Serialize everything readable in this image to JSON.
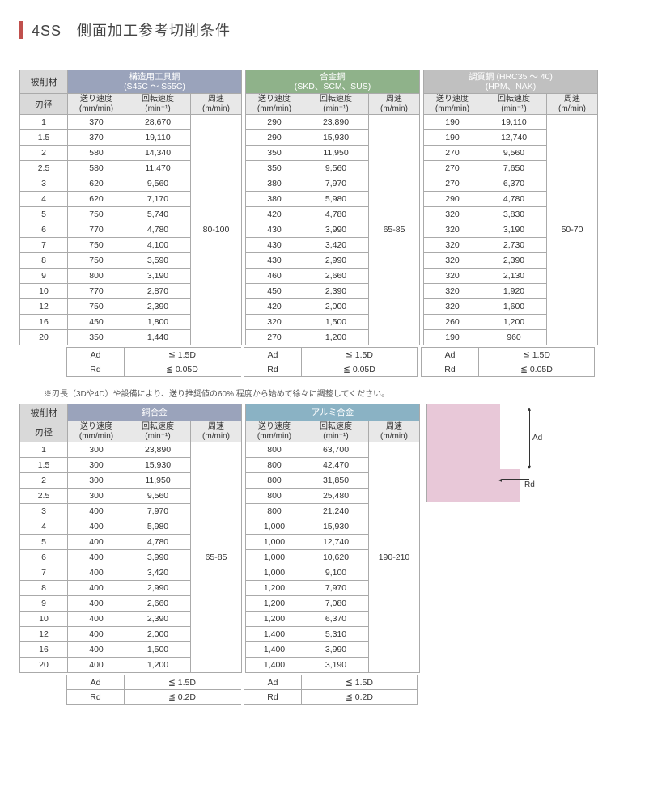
{
  "title": "4SS　側面加工参考切削条件",
  "labels": {
    "workpiece": "被削材",
    "edge": "刃径",
    "feed": "送り速度",
    "feed_u": "(mm/min)",
    "rpm": "回転速度",
    "rpm_u": "(min⁻¹)",
    "speed": "周速",
    "speed_u": "(m/min)",
    "Ad": "Ad",
    "Rd": "Rd"
  },
  "note": "※刃長（3Dや4D）や設備により、送り推奨値の60% 程度から始めて徐々に調整してください。",
  "materials1": [
    {
      "name_l1": "構造用工具鋼",
      "name_l2": "(S45C ～ S55C)",
      "speed": "80-100",
      "ad": "≦ 1.5D",
      "rd": "≦ 0.05D",
      "class": "mat-a",
      "rows": [
        [
          "370",
          "28,670"
        ],
        [
          "370",
          "19,110"
        ],
        [
          "580",
          "14,340"
        ],
        [
          "580",
          "11,470"
        ],
        [
          "620",
          "9,560"
        ],
        [
          "620",
          "7,170"
        ],
        [
          "750",
          "5,740"
        ],
        [
          "770",
          "4,780"
        ],
        [
          "750",
          "4,100"
        ],
        [
          "750",
          "3,590"
        ],
        [
          "800",
          "3,190"
        ],
        [
          "770",
          "2,870"
        ],
        [
          "750",
          "2,390"
        ],
        [
          "450",
          "1,800"
        ],
        [
          "350",
          "1,440"
        ]
      ]
    },
    {
      "name_l1": "合金鋼",
      "name_l2": "(SKD、SCM、SUS)",
      "speed": "65-85",
      "ad": "≦ 1.5D",
      "rd": "≦ 0.05D",
      "class": "mat-b",
      "rows": [
        [
          "290",
          "23,890"
        ],
        [
          "290",
          "15,930"
        ],
        [
          "350",
          "11,950"
        ],
        [
          "350",
          "9,560"
        ],
        [
          "380",
          "7,970"
        ],
        [
          "380",
          "5,980"
        ],
        [
          "420",
          "4,780"
        ],
        [
          "430",
          "3,990"
        ],
        [
          "430",
          "3,420"
        ],
        [
          "430",
          "2,990"
        ],
        [
          "460",
          "2,660"
        ],
        [
          "450",
          "2,390"
        ],
        [
          "420",
          "2,000"
        ],
        [
          "320",
          "1,500"
        ],
        [
          "270",
          "1,200"
        ]
      ]
    },
    {
      "name_l1": "調質鋼 (HRC35 ～ 40)",
      "name_l2": "(HPM、NAK)",
      "speed": "50-70",
      "ad": "≦ 1.5D",
      "rd": "≦ 0.05D",
      "class": "mat-c",
      "rows": [
        [
          "190",
          "19,110"
        ],
        [
          "190",
          "12,740"
        ],
        [
          "270",
          "9,560"
        ],
        [
          "270",
          "7,650"
        ],
        [
          "270",
          "6,370"
        ],
        [
          "290",
          "4,780"
        ],
        [
          "320",
          "3,830"
        ],
        [
          "320",
          "3,190"
        ],
        [
          "320",
          "2,730"
        ],
        [
          "320",
          "2,390"
        ],
        [
          "320",
          "2,130"
        ],
        [
          "320",
          "1,920"
        ],
        [
          "320",
          "1,600"
        ],
        [
          "260",
          "1,200"
        ],
        [
          "190",
          "960"
        ]
      ]
    }
  ],
  "materials2": [
    {
      "name_l1": "銅合金",
      "name_l2": "",
      "speed": "65-85",
      "ad": "≦ 1.5D",
      "rd": "≦ 0.2D",
      "class": "mat-d",
      "rows": [
        [
          "300",
          "23,890"
        ],
        [
          "300",
          "15,930"
        ],
        [
          "300",
          "11,950"
        ],
        [
          "300",
          "9,560"
        ],
        [
          "400",
          "7,970"
        ],
        [
          "400",
          "5,980"
        ],
        [
          "400",
          "4,780"
        ],
        [
          "400",
          "3,990"
        ],
        [
          "400",
          "3,420"
        ],
        [
          "400",
          "2,990"
        ],
        [
          "400",
          "2,660"
        ],
        [
          "400",
          "2,390"
        ],
        [
          "400",
          "2,000"
        ],
        [
          "400",
          "1,500"
        ],
        [
          "400",
          "1,200"
        ]
      ]
    },
    {
      "name_l1": "アルミ合金",
      "name_l2": "",
      "speed": "190-210",
      "ad": "≦ 1.5D",
      "rd": "≦ 0.2D",
      "class": "mat-e",
      "rows": [
        [
          "800",
          "63,700"
        ],
        [
          "800",
          "42,470"
        ],
        [
          "800",
          "31,850"
        ],
        [
          "800",
          "25,480"
        ],
        [
          "800",
          "21,240"
        ],
        [
          "1,000",
          "15,930"
        ],
        [
          "1,000",
          "12,740"
        ],
        [
          "1,000",
          "10,620"
        ],
        [
          "1,000",
          "9,100"
        ],
        [
          "1,200",
          "7,970"
        ],
        [
          "1,200",
          "7,080"
        ],
        [
          "1,200",
          "6,370"
        ],
        [
          "1,400",
          "5,310"
        ],
        [
          "1,400",
          "3,990"
        ],
        [
          "1,400",
          "3,190"
        ]
      ]
    }
  ],
  "diameters": [
    "1",
    "1.5",
    "2",
    "2.5",
    "3",
    "4",
    "5",
    "6",
    "7",
    "8",
    "9",
    "10",
    "12",
    "16",
    "20"
  ],
  "diagram": {
    "ad": "Ad",
    "rd": "Rd"
  }
}
